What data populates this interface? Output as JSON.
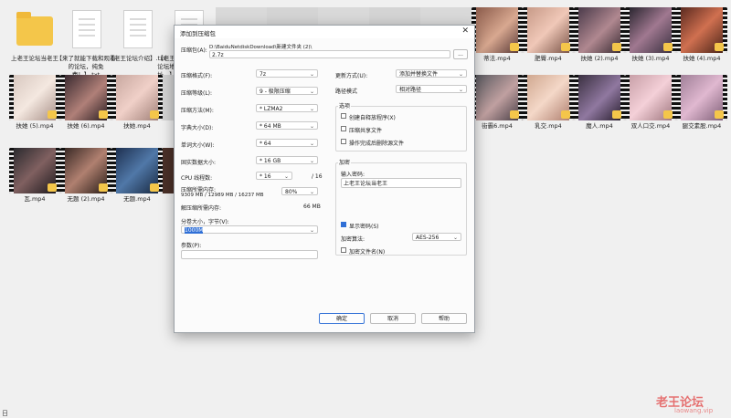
{
  "desktop": {
    "row1": [
      {
        "type": "folder",
        "label": "上老王论坛当老王"
      },
      {
        "type": "doc",
        "label": "【来了就能下载和观看的论坛，纯免费！】.txt"
      },
      {
        "type": "doc",
        "label": "【老王论坛介绍】.txt"
      },
      {
        "type": "doc",
        "label": "【老王论坛地址...】"
      },
      {
        "type": "video",
        "label": "蒂法.mp4"
      },
      {
        "type": "video",
        "label": "肥臀.mp4"
      },
      {
        "type": "video",
        "label": "扶她 (2).mp4"
      },
      {
        "type": "video",
        "label": "扶她 (3).mp4"
      },
      {
        "type": "video",
        "label": "扶她 (4).mp4"
      }
    ],
    "row2": [
      {
        "type": "video",
        "label": "扶她 (5).mp4"
      },
      {
        "type": "video",
        "label": "扶她 (6).mp4"
      },
      {
        "type": "video",
        "label": "扶她.mp4"
      },
      {
        "type": "video",
        "label": "街霸6.mp4"
      },
      {
        "type": "video",
        "label": "乳交.mp4"
      },
      {
        "type": "video",
        "label": "魔人.mp4"
      },
      {
        "type": "video",
        "label": "双人口交.mp4"
      },
      {
        "type": "video",
        "label": "腿交素股.mp4"
      }
    ],
    "row3": [
      {
        "type": "video",
        "label": "瓦.mp4"
      },
      {
        "type": "video",
        "label": "无题 (2).mp4"
      },
      {
        "type": "video",
        "label": "无题.mp4"
      }
    ]
  },
  "dialog": {
    "title": "添加到压缩包",
    "close_glyph": "✕",
    "archive_label": "压缩包(A):",
    "archive_path": "D:\\BaiduNetdiskDownload\\新建文件夹 (2)\\",
    "archive_name": "2.7z",
    "browse_label": "...",
    "format_label": "压缩格式(F):",
    "format_value": "7z",
    "level_label": "压缩等级(L):",
    "level_value": "9 - 极限压缩",
    "method_label": "压缩方法(M):",
    "method_value": "* LZMA2",
    "dict_label": "字典大小(D):",
    "dict_value": "* 64 MB",
    "word_label": "单词大小(W):",
    "word_value": "* 64",
    "solid_label": "固实数据大小:",
    "solid_value": "* 16 GB",
    "cpu_label": "CPU 线程数:",
    "cpu_value": "* 16",
    "cpu_total": "/ 16",
    "mem_label": "压缩所需内存:",
    "mem_detail": "9309 MB / 12989 MB / 16237 MB",
    "mem_percent": "80%",
    "decomp_label": "解压缩所需内存:",
    "decomp_value": "66 MB",
    "split_label": "分卷大小，字节(V):",
    "split_value": "1000M",
    "params_label": "参数(P):",
    "params_value": "",
    "update_label": "更新方式(U):",
    "update_value": "添加并替换文件",
    "pathmode_label": "路径模式",
    "pathmode_value": "相对路径",
    "options_title": "选项",
    "opt_sfx": "创建自释放程序(X)",
    "opt_shared": "压缩共享文件",
    "opt_delete": "操作完成后删除源文件",
    "enc_title": "加密",
    "enc_input_label": "输入密码:",
    "enc_password": "上老王论坛当老王",
    "show_pwd": "显示密码(S)",
    "enc_method_label": "加密算法:",
    "enc_method_value": "AES-256",
    "enc_names": "加密文件名(N)",
    "ok": "确定",
    "cancel": "取消",
    "help": "帮助"
  },
  "watermark": {
    "text": "老王论坛",
    "sub": "laowang.vip"
  },
  "corner_glyph": "日",
  "colors": {
    "accent": "#2f6fd6",
    "watermark": "#e45a5a",
    "folder": "#f4c64a"
  }
}
